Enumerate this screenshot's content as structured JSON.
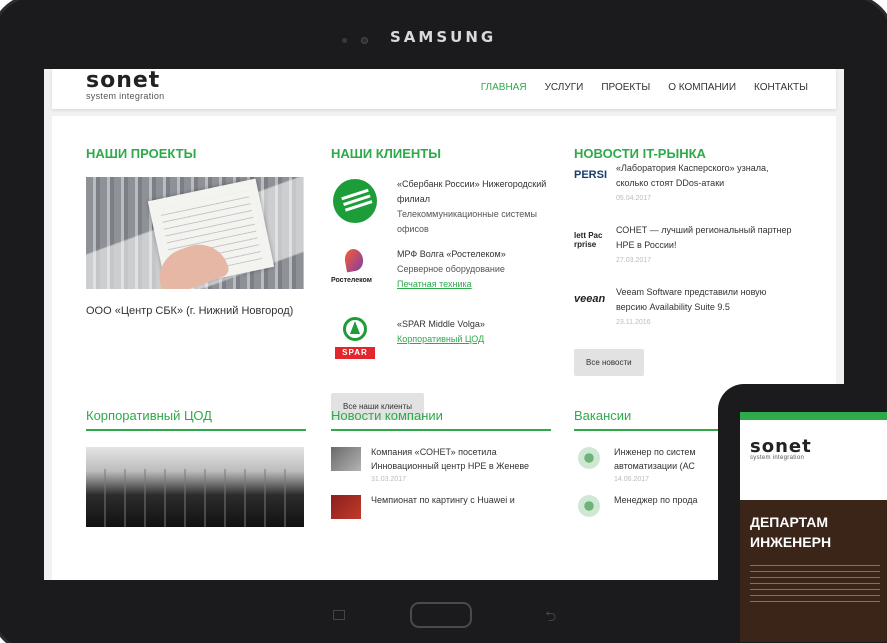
{
  "device": {
    "brand": "SAMSUNG"
  },
  "site": {
    "logo": {
      "word": "sonet",
      "sub": "system integration"
    },
    "nav": [
      "ГЛАВНАЯ",
      "УСЛУГИ",
      "ПРОЕКТЫ",
      "О КОМПАНИИ",
      "КОНТАКТЫ"
    ]
  },
  "projects": {
    "title": "НАШИ ПРОЕКТЫ",
    "caption": "ООО «Центр СБК» (г. Нижний Новгород)"
  },
  "clients": {
    "title": "НАШИ КЛИЕНТЫ",
    "items": [
      {
        "name": "«Сбербанк России» Нижегородский филиал",
        "desc": "Телекоммуникационные системы офисов",
        "link": ""
      },
      {
        "name": "МРФ Волга «Ростелеком»",
        "desc": "Серверное оборудование",
        "link": "Печатная техника"
      },
      {
        "name": "«SPAR Middle Volga»",
        "desc": "",
        "link": "Корпоративный ЦОД"
      }
    ],
    "logo_texts": {
      "rostelecom": "Ростелеком",
      "spar": "SPAR"
    },
    "button": "Все наши клиенты"
  },
  "news": {
    "title": "НОВОСТИ IT-РЫНКА",
    "items": [
      {
        "logo": "PERSI",
        "text": "«Лаборатория Касперского» узнала, сколько стоят DDos-атаки",
        "date": "05.04.2017"
      },
      {
        "logo": "lett Pac rprise",
        "text": "СОНЕТ — лучший региональный партнер HPE в России!",
        "date": "27.03.2017"
      },
      {
        "logo": "veean",
        "text": "Veeam Software представили новую версию Availability Suite 9.5",
        "date": "23.11.2016"
      }
    ],
    "button": "Все новости"
  },
  "datacenter": {
    "title": "Корпоративный ЦОД"
  },
  "company_news": {
    "title": "Новости компании",
    "items": [
      {
        "text1": "Компания «СОНЕТ» посетила",
        "text2": "Инновационный центр HPE в Женеве",
        "date": "31.03.2017"
      },
      {
        "text1": "Чемпионат по картингу с Huawei и",
        "text2": "",
        "date": ""
      }
    ]
  },
  "vacancies": {
    "title": "Вакансии",
    "items": [
      {
        "text1": "Инженер по систем",
        "text2": "автоматизации (АС",
        "date": "14.06.2017"
      },
      {
        "text1": "Менеджер по прода",
        "text2": "",
        "date": ""
      }
    ]
  },
  "phone": {
    "logo": {
      "word": "sonet",
      "sub": "system integration"
    },
    "hero_line1": "ДЕПАРТАМ",
    "hero_line2": "ИНЖЕНЕРН"
  },
  "colors": {
    "accent": "#2eaa4a",
    "device": "#1b1b1d"
  }
}
